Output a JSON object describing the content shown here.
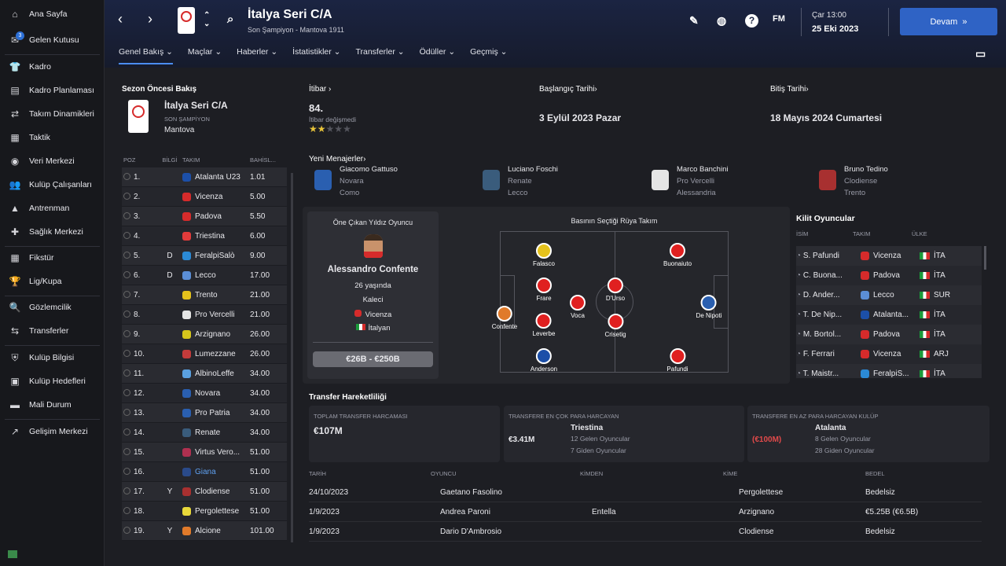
{
  "sidebar": {
    "items": [
      {
        "label": "Ana Sayfa",
        "icon": "home-icon",
        "glyph": "⌂"
      },
      {
        "label": "Gelen Kutusu",
        "icon": "inbox-icon",
        "glyph": "✉",
        "badge": "3"
      },
      {
        "label": "Kadro",
        "icon": "shirt-icon",
        "glyph": "👕"
      },
      {
        "label": "Kadro Planlaması",
        "icon": "clipboard-icon",
        "glyph": "▤"
      },
      {
        "label": "Takım Dinamikleri",
        "icon": "dynamics-icon",
        "glyph": "⇄"
      },
      {
        "label": "Taktik",
        "icon": "tactics-icon",
        "glyph": "▦"
      },
      {
        "label": "Veri Merkezi",
        "icon": "data-icon",
        "glyph": "◉"
      },
      {
        "label": "Kulüp Çalışanları",
        "icon": "staff-icon",
        "glyph": "👥"
      },
      {
        "label": "Antrenman",
        "icon": "training-icon",
        "glyph": "▲"
      },
      {
        "label": "Sağlık Merkezi",
        "icon": "medical-icon",
        "glyph": "✚"
      },
      {
        "label": "Fikstür",
        "icon": "calendar-icon",
        "glyph": "▦"
      },
      {
        "label": "Lig/Kupa",
        "icon": "trophy-icon",
        "glyph": "🏆"
      },
      {
        "label": "Gözlemcilik",
        "icon": "scouting-icon",
        "glyph": "🔍"
      },
      {
        "label": "Transferler",
        "icon": "transfer-icon",
        "glyph": "⇆"
      },
      {
        "label": "Kulüp Bilgisi",
        "icon": "shield-icon",
        "glyph": "⛨"
      },
      {
        "label": "Kulüp Hedefleri",
        "icon": "briefcase-icon",
        "glyph": "▣"
      },
      {
        "label": "Mali Durum",
        "icon": "money-icon",
        "glyph": "▬"
      },
      {
        "label": "Gelişim Merkezi",
        "icon": "development-icon",
        "glyph": "↗"
      }
    ]
  },
  "header": {
    "title": "İtalya Seri C/A",
    "subtitle": "Son Şampiyon - Mantova 1911",
    "date_day": "Çar 13:00",
    "date_full": "25 Eki 2023",
    "continue": "Devam",
    "fm": "FM"
  },
  "tabs": [
    "Genel Bakış",
    "Maçlar",
    "Haberler",
    "İstatistikler",
    "Transferler",
    "Ödüller",
    "Geçmiş"
  ],
  "overview": {
    "section": "Sezon Öncesi Bakış",
    "league": "İtalya Seri C/A",
    "champ_label": "SON ŞAMPİYON",
    "champ": "Mantova"
  },
  "league_table": {
    "headers": [
      "POZ",
      "BİLGİ",
      "TAKIM",
      "BAHİSL..."
    ],
    "rows": [
      {
        "pos": "1.",
        "info": "",
        "team": "Atalanta U23",
        "odds": "1.01",
        "color": "#1c4fa8"
      },
      {
        "pos": "2.",
        "info": "",
        "team": "Vicenza",
        "odds": "5.00",
        "color": "#d62b2b"
      },
      {
        "pos": "3.",
        "info": "",
        "team": "Padova",
        "odds": "5.50",
        "color": "#d62b2b"
      },
      {
        "pos": "4.",
        "info": "",
        "team": "Triestina",
        "odds": "6.00",
        "color": "#e23b3b"
      },
      {
        "pos": "5.",
        "info": "D",
        "team": "FeralpiSalò",
        "odds": "9.00",
        "color": "#2b8ad6"
      },
      {
        "pos": "6.",
        "info": "D",
        "team": "Lecco",
        "odds": "17.00",
        "color": "#5b8ed6"
      },
      {
        "pos": "7.",
        "info": "",
        "team": "Trento",
        "odds": "21.00",
        "color": "#e5c21c"
      },
      {
        "pos": "8.",
        "info": "",
        "team": "Pro Vercelli",
        "odds": "21.00",
        "color": "#e5e5e5"
      },
      {
        "pos": "9.",
        "info": "",
        "team": "Arzignano",
        "odds": "26.00",
        "color": "#d6c61c"
      },
      {
        "pos": "10.",
        "info": "",
        "team": "Lumezzane",
        "odds": "26.00",
        "color": "#c43b3b"
      },
      {
        "pos": "11.",
        "info": "",
        "team": "AlbinoLeffe",
        "odds": "34.00",
        "color": "#5aa0e0"
      },
      {
        "pos": "12.",
        "info": "",
        "team": "Novara",
        "odds": "34.00",
        "color": "#2a5fb0"
      },
      {
        "pos": "13.",
        "info": "",
        "team": "Pro Patria",
        "odds": "34.00",
        "color": "#2a5fb0"
      },
      {
        "pos": "14.",
        "info": "",
        "team": "Renate",
        "odds": "34.00",
        "color": "#3a5c7c"
      },
      {
        "pos": "15.",
        "info": "",
        "team": "Virtus Vero...",
        "odds": "51.00",
        "color": "#b03050"
      },
      {
        "pos": "16.",
        "info": "",
        "team": "Giana",
        "odds": "51.00",
        "color": "#2a4a8a"
      },
      {
        "pos": "17.",
        "info": "Y",
        "team": "Clodiense",
        "odds": "51.00",
        "color": "#a83030"
      },
      {
        "pos": "18.",
        "info": "",
        "team": "Pergolettese",
        "odds": "51.00",
        "color": "#e8d83a"
      },
      {
        "pos": "19.",
        "info": "Y",
        "team": "Alcione",
        "odds": "101.00",
        "color": "#e07a2a"
      }
    ]
  },
  "reputation": {
    "label": "İtibar",
    "value": "84.",
    "note": "İtibar değişmedi",
    "stars": 2
  },
  "start": {
    "label": "Başlangıç Tarihi",
    "value": "3 Eylül 2023 Pazar"
  },
  "end": {
    "label": "Bitiş Tarihi",
    "value": "18 Mayıs 2024 Cumartesi"
  },
  "managers": {
    "label": "Yeni Menajerler",
    "items": [
      {
        "name": "Giacomo Gattuso",
        "club": "Novara",
        "prev": "Como",
        "color": "#2a5fb0"
      },
      {
        "name": "Luciano Foschi",
        "club": "Renate",
        "prev": "Lecco",
        "color": "#3a5c7c"
      },
      {
        "name": "Marco Banchini",
        "club": "Pro Vercelli",
        "prev": "Alessandria",
        "color": "#e5e5e5"
      },
      {
        "name": "Bruno Tedino",
        "club": "Clodiense",
        "prev": "Trento",
        "color": "#a83030"
      }
    ]
  },
  "star": {
    "title": "Öne Çıkan Yıldız Oyuncu",
    "name": "Alessandro Confente",
    "age": "26 yaşında",
    "position": "Kaleci",
    "club": "Vicenza",
    "nation": "İtalyan",
    "value": "€26B - €250B"
  },
  "dream": {
    "title": "Basının Seçtiği Rüya Takım",
    "players": [
      {
        "name": "Confente",
        "color": "#e07a2a"
      },
      {
        "name": "Falasco",
        "color": "#e5c21c"
      },
      {
        "name": "Frare",
        "color": "#e02020"
      },
      {
        "name": "Leverbe",
        "color": "#e02020"
      },
      {
        "name": "Anderson",
        "color": "#1c4fa8"
      },
      {
        "name": "Voca",
        "color": "#e02020"
      },
      {
        "name": "D'Urso",
        "color": "#e02020"
      },
      {
        "name": "Crisetig",
        "color": "#e02020"
      },
      {
        "name": "Buonaiuto",
        "color": "#e02020"
      },
      {
        "name": "Pafundi",
        "color": "#e02020"
      },
      {
        "name": "De Nipoti",
        "color": "#2a5fb0"
      }
    ]
  },
  "key_players": {
    "title": "Kilit Oyuncular",
    "headers": [
      "İSİM",
      "TAKIM",
      "ÜLKE"
    ],
    "rows": [
      {
        "name": "S. Pafundi",
        "team": "Vicenza",
        "nat": "İTA",
        "color": "#d62b2b"
      },
      {
        "name": "C. Buona...",
        "team": "Padova",
        "nat": "İTA",
        "color": "#d62b2b"
      },
      {
        "name": "D. Ander...",
        "team": "Lecco",
        "nat": "SUR",
        "color": "#5b8ed6"
      },
      {
        "name": "T. De Nip...",
        "team": "Atalanta...",
        "nat": "İTA",
        "color": "#1c4fa8"
      },
      {
        "name": "M. Bortol...",
        "team": "Padova",
        "nat": "İTA",
        "color": "#d62b2b"
      },
      {
        "name": "F. Ferrari",
        "team": "Vicenza",
        "nat": "ARJ",
        "color": "#d62b2b"
      },
      {
        "name": "T. Maistr...",
        "team": "FeralpiS...",
        "nat": "İTA",
        "color": "#2b8ad6"
      }
    ]
  },
  "transfer_activity": {
    "title": "Transfer Hareketliliği",
    "total_label": "TOPLAM TRANSFER HARCAMASI",
    "total": "€107M",
    "most_label": "TRANSFERE EN ÇOK PARA HARCAYAN",
    "most_value": "€3.41M",
    "most_club": "Triestina",
    "most_in": "12 Gelen Oyuncular",
    "most_out": "7 Giden Oyuncular",
    "least_label": "TRANSFERE EN AZ PARA HARCAYAN KULÜP",
    "least_value": "(€100M)",
    "least_club": "Atalanta",
    "least_in": "8 Gelen Oyuncular",
    "least_out": "28 Giden Oyuncular"
  },
  "transfers": {
    "headers": [
      "TARİH",
      "OYUNCU",
      "KİMDEN",
      "KİME",
      "BEDEL"
    ],
    "rows": [
      {
        "date": "24/10/2023",
        "player": "Gaetano Fasolino",
        "from": "",
        "to": "Pergolettese",
        "fee": "Bedelsiz"
      },
      {
        "date": "1/9/2023",
        "player": "Andrea Paroni",
        "from": "Entella",
        "to": "Arzignano",
        "fee": "€5.25B (€6.5B)"
      },
      {
        "date": "1/9/2023",
        "player": "Dario D'Ambrosio",
        "from": "",
        "to": "Clodiense",
        "fee": "Bedelsiz"
      }
    ]
  }
}
